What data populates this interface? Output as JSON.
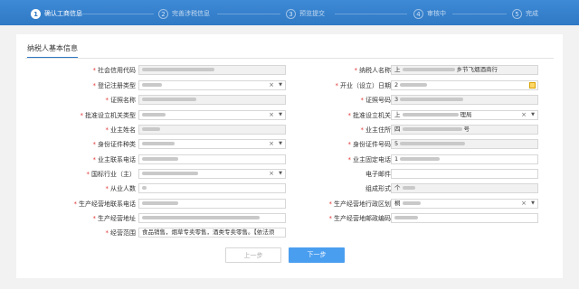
{
  "steps": [
    {
      "num": "1",
      "label": "确认工商信息"
    },
    {
      "num": "2",
      "label": "完善涉税信息"
    },
    {
      "num": "3",
      "label": "预览提交"
    },
    {
      "num": "4",
      "label": "审核中"
    },
    {
      "num": "5",
      "label": "完成"
    }
  ],
  "section_title": "纳税人基本信息",
  "left_fields": {
    "credit_code": {
      "label": "社会信用代码"
    },
    "reg_type": {
      "label": "登记注册类型"
    },
    "cert_name": {
      "label": "证照名称"
    },
    "approve_type": {
      "label": "批准设立机关类型"
    },
    "owner_name": {
      "label": "业主姓名"
    },
    "id_type": {
      "label": "身份证件种类"
    },
    "owner_phone": {
      "label": "业主联系电话"
    },
    "industry": {
      "label": "国标行业（主）"
    },
    "employees": {
      "label": "从业人数"
    },
    "biz_phone": {
      "label": "生产经营地联系电话"
    },
    "biz_address": {
      "label": "生产经营地址"
    },
    "biz_scope": {
      "label": "经营范围",
      "value": "食品销售，烟草专卖零售，酒类专卖零售。【依法须"
    }
  },
  "right_fields": {
    "taxpayer_name": {
      "label": "纳税人名称",
      "value_suffix": "乡节飞烟酒商行",
      "value_prefix": "上"
    },
    "open_date": {
      "label": "开业（设立）日期",
      "value_prefix": "2"
    },
    "cert_no": {
      "label": "证照号码",
      "value_prefix": "3"
    },
    "approve_org": {
      "label": "批准设立机关",
      "value_prefix": "上",
      "value_suffix": "理局"
    },
    "owner_address": {
      "label": "业主住所",
      "value_prefix": "四",
      "value_suffix": "号"
    },
    "id_no": {
      "label": "身份证件号码",
      "value_prefix": "5"
    },
    "owner_fixed_phone": {
      "label": "业主固定电话",
      "value_prefix": "1"
    },
    "email": {
      "label": "电子邮件"
    },
    "org_form": {
      "label": "组成形式",
      "value_prefix": "个"
    },
    "admin_region": {
      "label": "生产经营地行政区划",
      "value_prefix": "桐"
    },
    "postal_code": {
      "label": "生产经营地邮政编码"
    }
  },
  "icons": {
    "clear": "×",
    "caret": "▼"
  },
  "buttons": {
    "prev": "上一步",
    "next": "下一步"
  },
  "colors": {
    "accent": "#2f78c4",
    "next_button": "#4a9ef0",
    "required": "#e23b3b"
  }
}
